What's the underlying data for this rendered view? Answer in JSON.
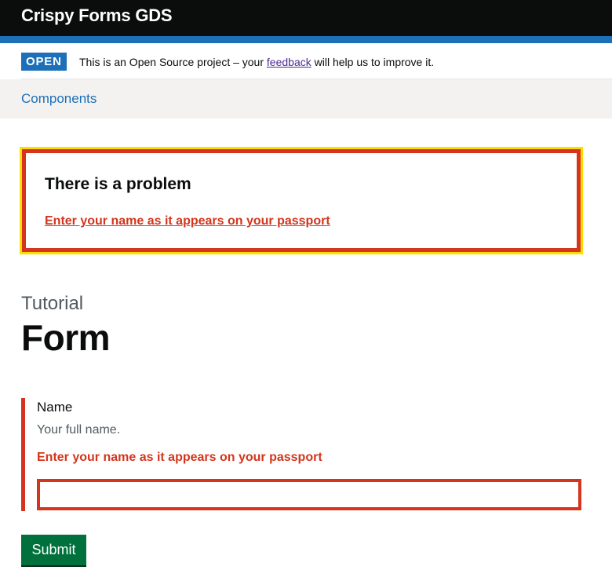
{
  "header": {
    "title": "Crispy Forms GDS"
  },
  "phase_banner": {
    "tag": "OPEN",
    "text_before": "This is an Open Source project – your ",
    "link_text": "feedback",
    "text_after": " will help us to improve it."
  },
  "nav": {
    "link": "Components"
  },
  "error_summary": {
    "title": "There is a problem",
    "errors": [
      "Enter your name as it appears on your passport"
    ]
  },
  "page": {
    "caption": "Tutorial",
    "heading": "Form"
  },
  "form": {
    "name_field": {
      "label": "Name",
      "hint": "Your full name.",
      "error": "Enter your name as it appears on your passport",
      "value": ""
    },
    "submit_label": "Submit"
  },
  "colors": {
    "header_bg": "#0b0c0c",
    "brand_blue": "#1d70b8",
    "error_red": "#d4351c",
    "focus_yellow": "#ffdd00",
    "button_green": "#00703c",
    "visited_link": "#4c2c92"
  }
}
